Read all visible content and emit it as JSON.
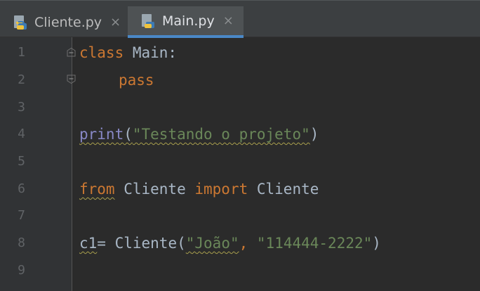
{
  "tabs": [
    {
      "label": "Cliente.py",
      "close": "×",
      "active": false
    },
    {
      "label": "Main.py",
      "close": "×",
      "active": true
    }
  ],
  "icons": {
    "tab_file": "python-file-icon",
    "close": "close-icon"
  },
  "editor": {
    "line_numbers": [
      "1",
      "2",
      "3",
      "4",
      "5",
      "6",
      "7",
      "8",
      "9"
    ],
    "lines": {
      "l1": {
        "kw": "class",
        "rest": " Main:"
      },
      "l2": {
        "kw": "pass"
      },
      "l4": {
        "fn": "print",
        "open": "(",
        "str": "\"Testando o projeto\"",
        "close": ")"
      },
      "l6": {
        "kw1": "from",
        "mod": " Cliente ",
        "kw2": "import",
        "name": " Cliente"
      },
      "l8": {
        "var": "c1",
        "eq": "=",
        "call": " Cliente(",
        "str1": "\"João\"",
        "comma": ", ",
        "str2": "\"114444-2222\"",
        "close": ")"
      }
    }
  },
  "colors": {
    "background": "#2b2b2b",
    "gutter": "#313335",
    "keyword": "#cc7832",
    "string": "#6a8759",
    "builtin": "#8888c6",
    "text": "#a9b7c6",
    "active_tab_underline": "#4a88c7"
  }
}
